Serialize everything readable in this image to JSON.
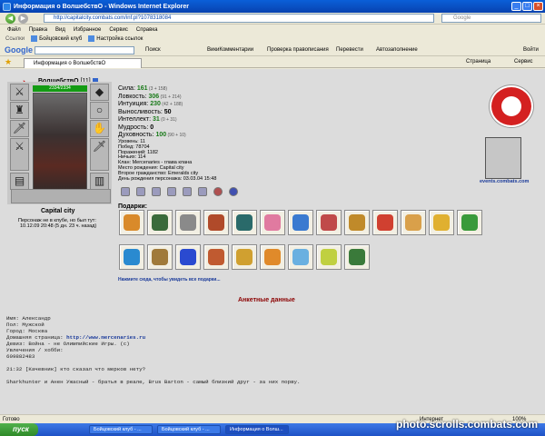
{
  "window": {
    "title": "Информация о ВолшебствО - Windows Internet Explorer"
  },
  "address": {
    "url": "http://capitalcity.combats.com/inf.pl?1078318084",
    "search_placeholder": "Google"
  },
  "menu": [
    "Файл",
    "Правка",
    "Вид",
    "Избранное",
    "Сервис",
    "Справка"
  ],
  "links": {
    "label": "Ссылки",
    "items": [
      "Бойцовский клуб",
      "Настройка ссылок"
    ]
  },
  "google_toolbar": {
    "logo": "Google",
    "items": [
      "Поиск",
      "ВикиКомментарии",
      "Проверка правописания",
      "Перевести",
      "Автозаполнение",
      "Войти"
    ]
  },
  "tab": {
    "title": "Информация о ВолшебствО",
    "page": "Страница",
    "tools": "Сервис"
  },
  "character": {
    "name": "ВолшебствО",
    "level": "[11]",
    "hp": "2334/2334"
  },
  "stats": [
    {
      "label": "Сила:",
      "value": "161",
      "extra": "(3 + 158)"
    },
    {
      "label": "Ловкость:",
      "value": "306",
      "extra": "(91 + 214)"
    },
    {
      "label": "Интуиция:",
      "value": "230",
      "extra": "(42 + 188)"
    },
    {
      "label": "Выносливость:",
      "value": "50",
      "extra": ""
    },
    {
      "label": "Интеллект:",
      "value": "31",
      "extra": "(0 + 31)"
    },
    {
      "label": "Мудрость:",
      "value": "0",
      "extra": ""
    },
    {
      "label": "Духовность:",
      "value": "100",
      "extra": "(90 + 10)"
    }
  ],
  "info": [
    "Уровень: 11",
    "Побед: 78704",
    "Поражений: 1182",
    "Ничьих: 114",
    "Клан: Mercenaries - глава клана",
    "Место рождения: Capital city",
    "Второе гражданство: Emeralds city",
    "День рождения персонажа: 03.03.04 15:48"
  ],
  "location": {
    "city": "Capital city",
    "line1": "Персонаж не в клубе, но был тут:",
    "line2": "10.12.09 20:48 (5 дн. 23 ч. назад)"
  },
  "gifts": {
    "header": "Подарки:",
    "note": "Нажмите сюда, чтобы увидеть все подарки...",
    "colors": [
      "#d98a2a",
      "#3a6a3a",
      "#8a8a8a",
      "#b04a2a",
      "#2a6a6a",
      "#e07aa0",
      "#3a7ad0",
      "#c04a4a",
      "#c08a2a",
      "#d04030",
      "#d9a04a",
      "#e0b030",
      "#3a9a3a",
      "#2a8ad0",
      "#a07a3a",
      "#2a4ad0",
      "#c05a30",
      "#d0a030",
      "#e08a2a",
      "#6ab0e0",
      "#c0d040",
      "#3a7a3a"
    ]
  },
  "events_link": "events.combats.com",
  "anket": {
    "title": "Анкетные данные",
    "name": "Имя: Александр",
    "gender": "Пол: Мужской",
    "city": "Город: Москва",
    "homepage_label": "Домашняя страница: ",
    "homepage": "http://www.mercenaries.ru",
    "motto": "Девиз: Война - не Олимпийские Игры. (c)",
    "hobby": "Увлечения / хобби:",
    "icq": "609882483",
    "quote1": "21:32 [Качевник] кто сказал что мерков нету?",
    "quote2": "Sharkhunter и Анен Ужасный - братья в реале, Brus Barton - самый близкий друг  - за них порву."
  },
  "status": {
    "left": "Готово",
    "zone": "Интернет",
    "zoom": "100%"
  },
  "taskbar": {
    "start": "пуск",
    "tasks": [
      "Бойцовский клуб - ...",
      "Бойцовский клуб - ...",
      "Информация о Волш..."
    ]
  },
  "watermark": "photo.scrolls.combats.com"
}
